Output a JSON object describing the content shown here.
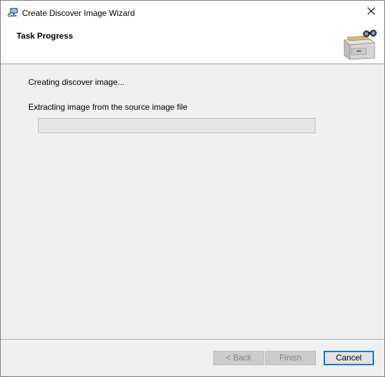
{
  "window": {
    "title": "Create Discover Image Wizard",
    "app_icon": "wizard-app-icon",
    "close_icon": "close-icon"
  },
  "header": {
    "title": "Task Progress",
    "icon": "file-cabinet-binoculars-icon"
  },
  "content": {
    "status": "Creating discover image...",
    "step": "Extracting image from the source image file",
    "progress": 0
  },
  "buttons": {
    "back": "< Back",
    "finish": "Finish",
    "cancel": "Cancel"
  },
  "colors": {
    "accent": "#0078d7",
    "dialog_bg": "#f0f0f0",
    "header_bg": "#ffffff",
    "progress_fill": "#06b025"
  }
}
